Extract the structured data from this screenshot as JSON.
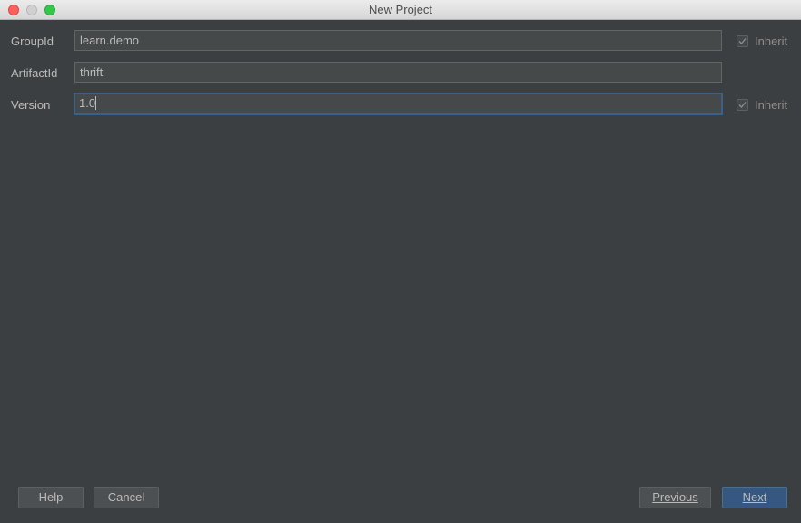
{
  "window": {
    "title": "New Project"
  },
  "form": {
    "group_id": {
      "label": "GroupId",
      "value": "learn.demo",
      "inherit_label": "Inherit",
      "inherit_checked": true
    },
    "artifact_id": {
      "label": "ArtifactId",
      "value": "thrift"
    },
    "version": {
      "label": "Version",
      "value": "1.0",
      "inherit_label": "Inherit",
      "inherit_checked": true
    }
  },
  "buttons": {
    "help": "Help",
    "cancel": "Cancel",
    "previous": "Previous",
    "next": "Next"
  },
  "colors": {
    "background": "#3c3f41",
    "field_background": "#45494a",
    "focus_border": "#3d6185",
    "primary_button": "#365880"
  }
}
